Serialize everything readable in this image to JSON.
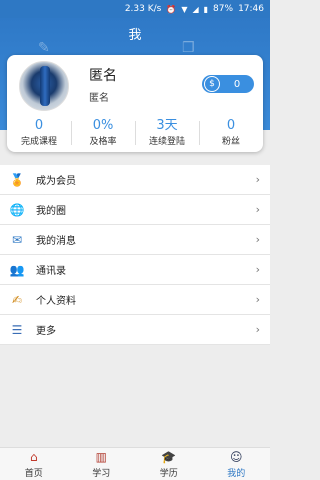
{
  "status_bar": {
    "speed": "2.33 K/s",
    "battery": "87%",
    "time": "17:46"
  },
  "header": {
    "title": "我"
  },
  "profile": {
    "name": "匿名",
    "subtitle": "匿名",
    "coins": "0"
  },
  "stats": [
    {
      "value": "0",
      "label": "完成课程"
    },
    {
      "value": "0%",
      "label": "及格率"
    },
    {
      "value": "3天",
      "label": "连续登陆"
    },
    {
      "value": "0",
      "label": "粉丝"
    }
  ],
  "menu": [
    {
      "label": "成为会员",
      "icon": "medal-icon"
    },
    {
      "label": "我的圈",
      "icon": "globe-icon"
    },
    {
      "label": "我的消息",
      "icon": "message-icon"
    },
    {
      "label": "通讯录",
      "icon": "contacts-icon"
    },
    {
      "label": "个人资料",
      "icon": "profile-edit-icon"
    },
    {
      "label": "更多",
      "icon": "more-icon"
    }
  ],
  "tabs": [
    {
      "label": "首页",
      "icon": "home-icon"
    },
    {
      "label": "学习",
      "icon": "book-icon"
    },
    {
      "label": "学历",
      "icon": "graduation-icon"
    },
    {
      "label": "我的",
      "icon": "person-icon",
      "active": true
    }
  ],
  "colors": {
    "primary": "#2e78c4",
    "accent": "#3a8fe0"
  }
}
